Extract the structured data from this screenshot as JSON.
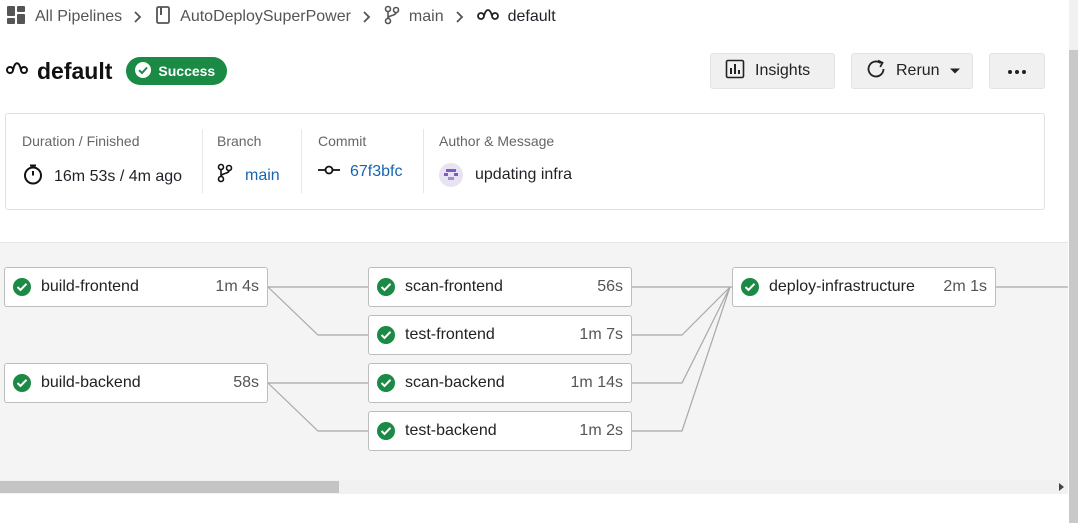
{
  "breadcrumb": {
    "items": [
      {
        "label": "All Pipelines",
        "icon": "grid-icon"
      },
      {
        "label": "AutoDeploySuperPower",
        "icon": "repo-icon"
      },
      {
        "label": "main",
        "icon": "branch-icon"
      },
      {
        "label": "default",
        "icon": "pipeline-icon"
      }
    ]
  },
  "header": {
    "title": "default",
    "status": "Success",
    "actions": {
      "insights": "Insights",
      "rerun": "Rerun"
    }
  },
  "info": {
    "duration_label": "Duration / Finished",
    "duration_value": "16m 53s / 4m ago",
    "branch_label": "Branch",
    "branch_value": "main",
    "commit_label": "Commit",
    "commit_value": "67f3bfc",
    "author_label": "Author & Message",
    "author_message": "updating infra"
  },
  "jobs": [
    {
      "name": "build-frontend",
      "duration": "1m 4s",
      "status": "success"
    },
    {
      "name": "build-backend",
      "duration": "58s",
      "status": "success"
    },
    {
      "name": "scan-frontend",
      "duration": "56s",
      "status": "success"
    },
    {
      "name": "test-frontend",
      "duration": "1m 7s",
      "status": "success"
    },
    {
      "name": "scan-backend",
      "duration": "1m 14s",
      "status": "success"
    },
    {
      "name": "test-backend",
      "duration": "1m 2s",
      "status": "success"
    },
    {
      "name": "deploy-infrastructure",
      "duration": "2m 1s",
      "status": "success"
    }
  ],
  "colors": {
    "success": "#1a8a45",
    "link": "#1665b3"
  }
}
